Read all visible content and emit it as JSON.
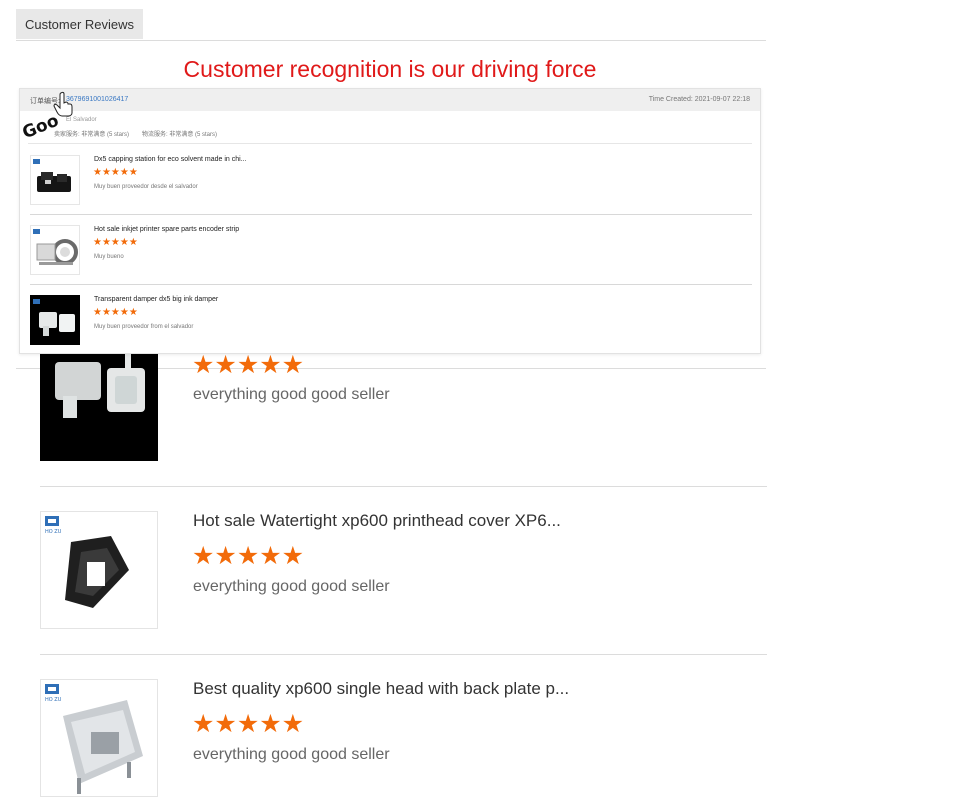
{
  "tabs": {
    "reviews_label": "Customer Reviews"
  },
  "headline": "Customer recognition is our driving force",
  "panel": {
    "order_label": "订单编号:",
    "order_number": "3679691001026417",
    "time_created": "Time Created: 2021-09-07 22:18",
    "country": "El Salvador",
    "rating_1": "卖家服务: 非常满意 (5 stars)",
    "rating_2": "物流服务: 非常满意 (5 stars)",
    "sticker_text": "Goo",
    "items": [
      {
        "title": "Dx5 capping station for eco solvent made in chi...",
        "stars": "★★★★★",
        "comment": "Muy buen proveedor desde el salvador"
      },
      {
        "title": "Hot sale inkjet printer spare parts encoder strip",
        "stars": "★★★★★",
        "comment": "Muy bueno"
      },
      {
        "title": "Transparent damper dx5 big ink damper",
        "stars": "★★★★★",
        "comment": "Muy buen proveedor from el salvador"
      }
    ]
  },
  "reviews": [
    {
      "title": "",
      "stars": "★★★★★",
      "comment": "everything good good seller"
    },
    {
      "title": "Hot sale Watertight xp600 printhead cover XP6...",
      "stars": "★★★★★",
      "comment": "everything good good seller"
    },
    {
      "title": "Best quality xp600 single head with back plate p...",
      "stars": "★★★★★",
      "comment": "everything good good seller"
    }
  ],
  "brand_text": "HO ZU",
  "colors": {
    "star": "#f26b0a",
    "headline": "#e01919",
    "link": "#3a78c3"
  }
}
